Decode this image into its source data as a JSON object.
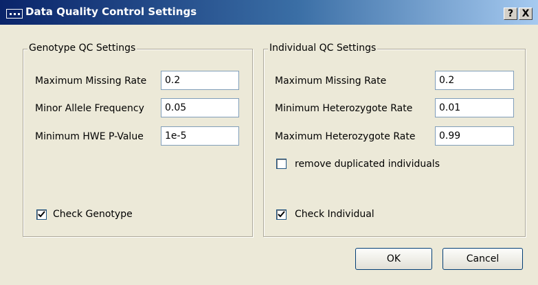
{
  "window": {
    "title": "Data Quality Control Settings",
    "help_glyph": "?",
    "close_glyph": "X"
  },
  "genotype": {
    "legend": "Genotype QC Settings",
    "max_missing_label": "Maximum Missing Rate",
    "max_missing_value": "0.2",
    "maf_label": "Minor Allele Frequency",
    "maf_value": "0.05",
    "hwe_label": "Minimum HWE P-Value",
    "hwe_value": "1e-5",
    "check_label": "Check Genotype",
    "check_checked": true
  },
  "individual": {
    "legend": "Individual QC Settings",
    "max_missing_label": "Maximum Missing Rate",
    "max_missing_value": "0.2",
    "min_het_label": "Minimum Heterozygote Rate",
    "min_het_value": "0.01",
    "max_het_label": "Maximum Heterozygote Rate",
    "max_het_value": "0.99",
    "remove_dup_label": "remove duplicated individuals",
    "remove_dup_checked": false,
    "check_label": "Check Individual",
    "check_checked": true
  },
  "buttons": {
    "ok": "OK",
    "cancel": "Cancel"
  }
}
